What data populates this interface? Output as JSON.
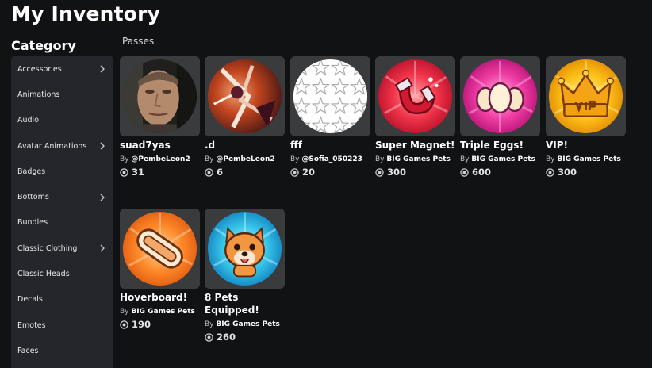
{
  "page": {
    "title": "My Inventory"
  },
  "sidebar": {
    "title": "Category",
    "items": [
      {
        "label": "Accessories",
        "has_submenu": true
      },
      {
        "label": "Animations",
        "has_submenu": false
      },
      {
        "label": "Audio",
        "has_submenu": false
      },
      {
        "label": "Avatar Animations",
        "has_submenu": true
      },
      {
        "label": "Badges",
        "has_submenu": false
      },
      {
        "label": "Bottoms",
        "has_submenu": true
      },
      {
        "label": "Bundles",
        "has_submenu": false
      },
      {
        "label": "Classic Clothing",
        "has_submenu": true
      },
      {
        "label": "Classic Heads",
        "has_submenu": false
      },
      {
        "label": "Decals",
        "has_submenu": false
      },
      {
        "label": "Emotes",
        "has_submenu": false
      },
      {
        "label": "Faces",
        "has_submenu": false
      }
    ]
  },
  "main": {
    "section_label": "Passes",
    "by_prefix": "By",
    "items": [
      {
        "name": "suad7yas",
        "creator": "@PembeLeon2",
        "price": "31",
        "icon": "face-photo-icon"
      },
      {
        "name": ".d",
        "creator": "@PembeLeon2",
        "price": "6",
        "icon": "abstract-art-icon"
      },
      {
        "name": "fff",
        "creator": "@Sofia_050223",
        "price": "20",
        "icon": "star-pattern-icon"
      },
      {
        "name": "Super Magnet!",
        "creator": "BIG Games Pets",
        "price": "300",
        "icon": "magnet-icon"
      },
      {
        "name": "Triple Eggs!",
        "creator": "BIG Games Pets",
        "price": "600",
        "icon": "eggs-icon"
      },
      {
        "name": "VIP!",
        "creator": "BIG Games Pets",
        "price": "300",
        "icon": "vip-crown-icon"
      },
      {
        "name": "Hoverboard!",
        "creator": "BIG Games Pets",
        "price": "190",
        "icon": "hoverboard-icon"
      },
      {
        "name": "8 Pets Equipped!",
        "creator": "BIG Games Pets",
        "price": "260",
        "icon": "dog-pet-icon"
      }
    ]
  },
  "colors": {
    "background": "#111214",
    "sidebar": "#24262b",
    "card_thumb": "#393b3d",
    "text": "#ffffff"
  }
}
